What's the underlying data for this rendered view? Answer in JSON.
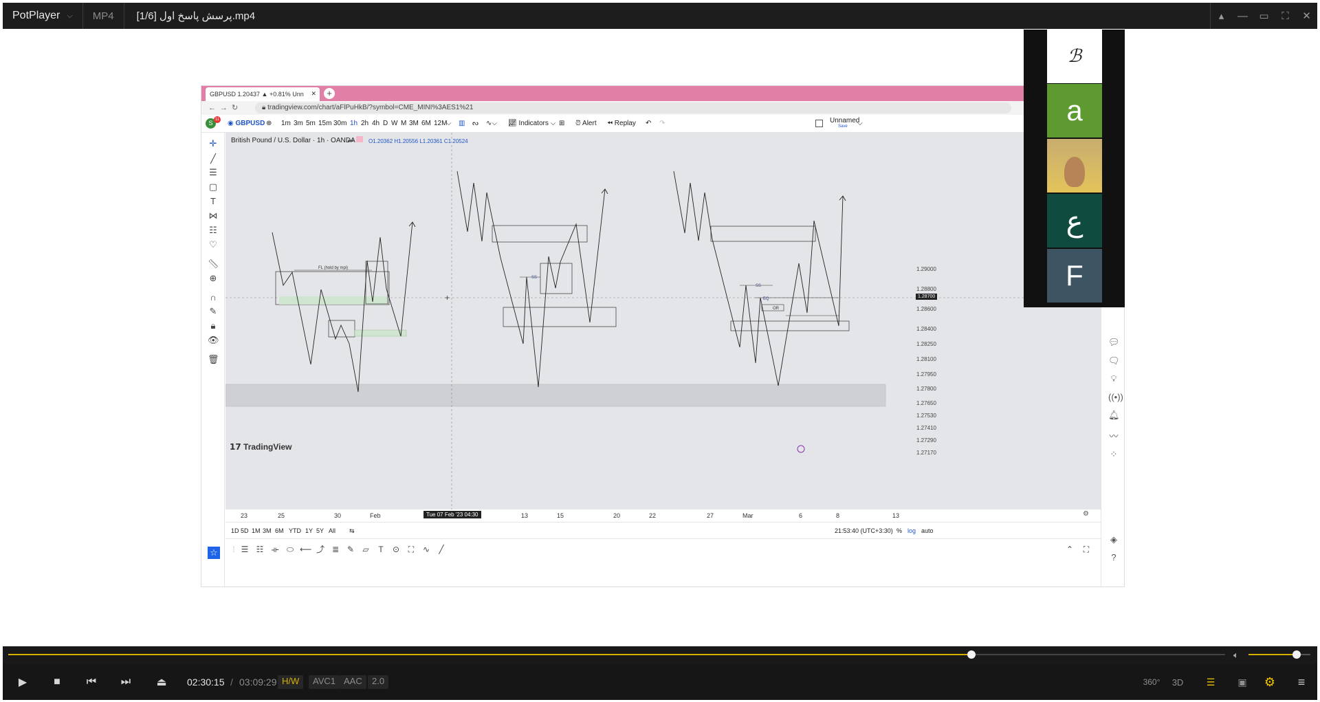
{
  "player": {
    "brand": "PotPlayer",
    "format": "MP4",
    "file_title": "[1/6] پرسش پاسخ اول.mp4",
    "window_buttons": [
      "pin-icon",
      "minimize-icon",
      "maximize-icon",
      "fullscreen-icon",
      "close-icon"
    ]
  },
  "browser": {
    "tab_title": "GBPUSD 1.20437 ▲ +0.81% Unn",
    "new_tab": "+",
    "url": "tradingview.com/chart/aFlPuHkB/?symbol=CME_MINI%3AES1%21"
  },
  "tradingview": {
    "avatar_letter": "S",
    "avatar_badge": "11",
    "symbol": "GBPUSD",
    "intervals": [
      "1m",
      "3m",
      "5m",
      "15m",
      "30m",
      "1h",
      "2h",
      "4h",
      "D",
      "W",
      "M",
      "3M",
      "6M",
      "12M"
    ],
    "active_interval": "1h",
    "indicators_label": "Indicators",
    "alert_label": "Alert",
    "replay_label": "Replay",
    "layout_name": "Unnamed",
    "layout_save": "Save",
    "chart_title": "British Pound / U.S. Dollar · 1h · OANDA",
    "ohlc": {
      "o": "O1.20362",
      "h": "H1.20556",
      "l": "L1.20361",
      "c": "C1.20524"
    },
    "watermark": "TradingView",
    "annotations": {
      "fl_label": "FL (hold by mpi)",
      "ss1": "SS",
      "ss2": "SS",
      "ss3": "SS",
      "eq": "EQ",
      "or": "OR"
    },
    "price_axis": [
      "1.29000",
      "1.28800",
      "1.28600",
      "1.28400",
      "1.28250",
      "1.28100",
      "1.27950",
      "1.27800",
      "1.27650",
      "1.27530",
      "1.27410",
      "1.27290",
      "1.27170"
    ],
    "crosshair_price": "1.28700",
    "time_axis": [
      "23",
      "25",
      "30",
      "Feb",
      "13",
      "15",
      "20",
      "22",
      "27",
      "Mar",
      "6",
      "8",
      "13"
    ],
    "crosshair_time": "Tue 07 Feb '23   04:30",
    "ranges": [
      "1D",
      "5D",
      "1M",
      "3M",
      "6M",
      "YTD",
      "1Y",
      "5Y",
      "All"
    ],
    "clock": "21:53:40 (UTC+3:30)",
    "scale_opts": [
      "%",
      "log",
      "auto"
    ]
  },
  "participants": [
    {
      "type": "image",
      "label": "",
      "color": "#ffffff"
    },
    {
      "type": "letter",
      "letter": "a",
      "color": "#5e9a2f"
    },
    {
      "type": "photo",
      "label": "",
      "color": "#c9a15c"
    },
    {
      "type": "letter",
      "letter": "ع",
      "color": "#0f4b3e"
    },
    {
      "type": "letter",
      "letter": "F",
      "color": "#3d5563"
    }
  ],
  "controls": {
    "time_current": "02:30:15",
    "time_sep": "/",
    "time_total": "03:09:29",
    "progress": 0.7915,
    "volume": 0.78,
    "badges": [
      "H/W",
      "AVC1",
      "AAC",
      "2.0"
    ],
    "right_icons": [
      "360-icon",
      "3d-icon",
      "playlist-search-icon",
      "subtitle-icon",
      "settings-gear-icon",
      "menu-icon"
    ],
    "label_360": "360°",
    "label_3d": "3D",
    "colors": {
      "accent": "#d7b000",
      "hw": "#d7b000",
      "gear": "#f0c400"
    }
  }
}
